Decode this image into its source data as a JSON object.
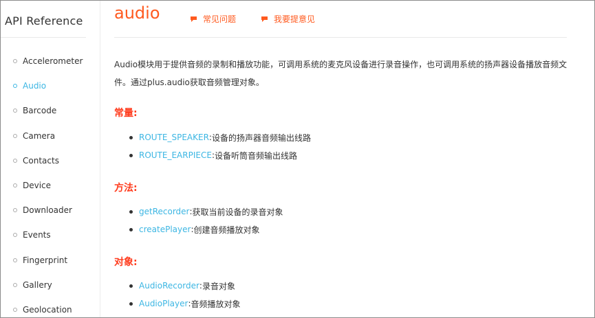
{
  "sidebar": {
    "title": "API Reference",
    "items": [
      {
        "label": "Accelerometer"
      },
      {
        "label": "Audio"
      },
      {
        "label": "Barcode"
      },
      {
        "label": "Camera"
      },
      {
        "label": "Contacts"
      },
      {
        "label": "Device"
      },
      {
        "label": "Downloader"
      },
      {
        "label": "Events"
      },
      {
        "label": "Fingerprint"
      },
      {
        "label": "Gallery"
      },
      {
        "label": "Geolocation"
      }
    ],
    "active_item": "Audio"
  },
  "header": {
    "title": "audio",
    "faq_link": "常见问题",
    "feedback_link": "我要提意见"
  },
  "main": {
    "description": "Audio模块用于提供音频的录制和播放功能，可调用系统的麦克风设备进行录音操作，也可调用系统的扬声器设备播放音频文件。通过plus.audio获取音频管理对象。",
    "constants_heading": "常量:",
    "constants": [
      {
        "name": "ROUTE_SPEAKER",
        "sep": ": ",
        "desc": "设备的扬声器音频输出线路"
      },
      {
        "name": "ROUTE_EARPIECE",
        "sep": ": ",
        "desc": "设备听筒音频输出线路"
      }
    ],
    "methods_heading": "方法:",
    "methods": [
      {
        "name": "getRecorder",
        "sep": ": ",
        "desc": "获取当前设备的录音对象"
      },
      {
        "name": "createPlayer",
        "sep": ": ",
        "desc": "创建音频播放对象"
      }
    ],
    "objects_heading": "对象:",
    "objects": [
      {
        "name": "AudioRecorder",
        "sep": ": ",
        "desc": "录音对象"
      },
      {
        "name": "AudioPlayer",
        "sep": ": ",
        "desc": "音频播放对象"
      }
    ]
  },
  "colors": {
    "accent_orange": "#ff5a1f",
    "heading_red": "#ff3c1e",
    "link_blue": "#3cb6e3",
    "text": "#333333"
  },
  "icons": {
    "faq": "speech-bubble-icon",
    "feedback": "speech-bubble-icon"
  }
}
